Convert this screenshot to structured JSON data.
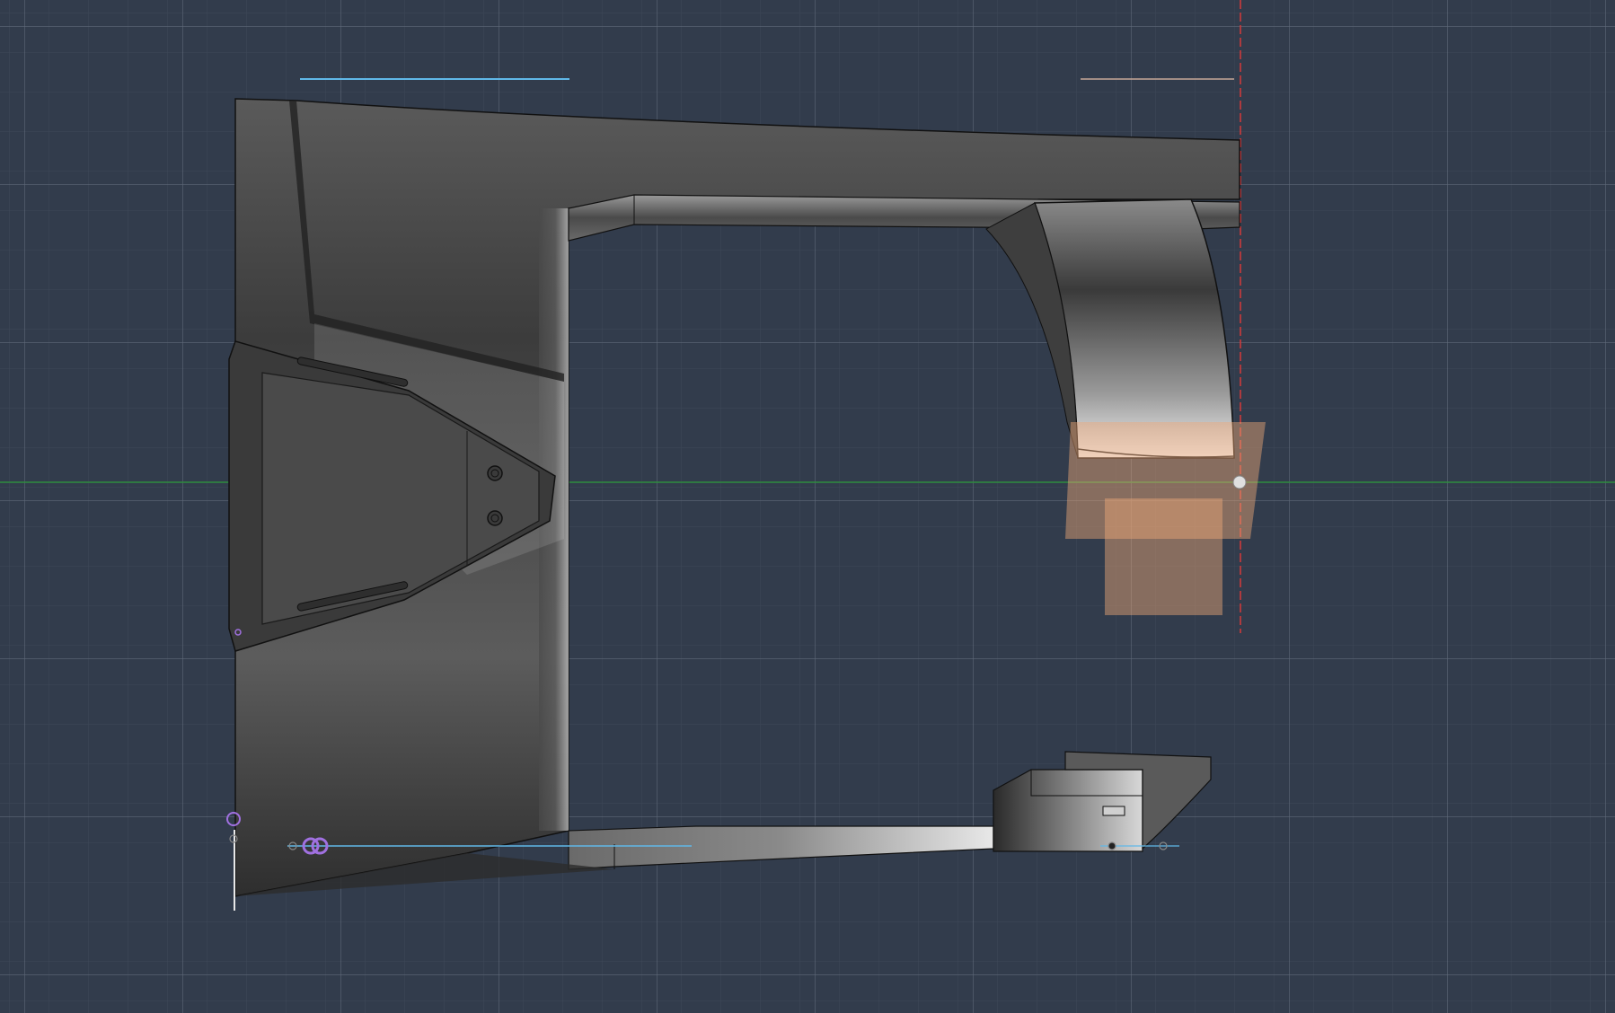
{
  "viewport": {
    "name": "cad-3d-viewport",
    "background_color": "#323c4c",
    "grid": {
      "visible": true,
      "minor_color": "#3e4858",
      "major_color": "#5e6878"
    },
    "axes": {
      "x_axis_color": "#2e8b3e",
      "z_axis_color": "#d63a3a"
    },
    "model": {
      "part": "sheet-metal-bracket",
      "view": "orthographic-side",
      "shading": "grey-metal",
      "highlight_color": "#f0a878"
    },
    "markers": {
      "constraint_color": "#a070e0",
      "reference_line_color": "#60b8e8",
      "reference_line_2_color": "#c8a898"
    }
  }
}
